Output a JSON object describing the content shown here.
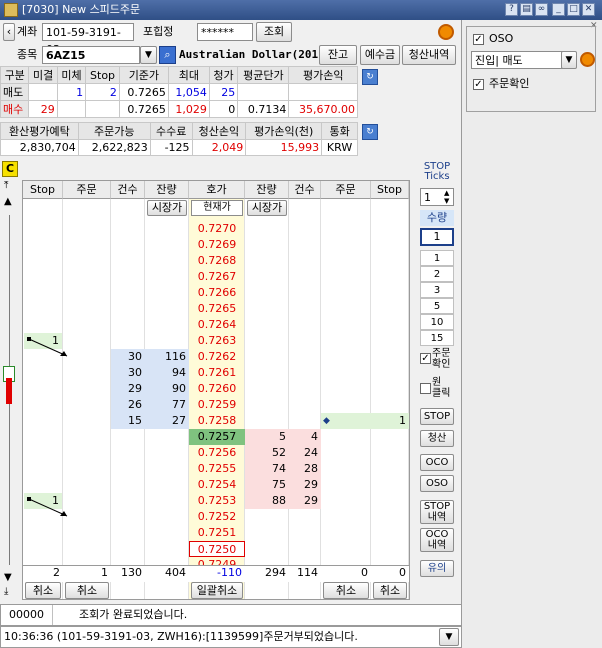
{
  "window": {
    "title": "[7030] New 스피드주문"
  },
  "account": {
    "label": "계좌",
    "number": "101-59-3191-03",
    "pw_label": "포힙정",
    "password": "******",
    "query_button": "조회"
  },
  "symbol": {
    "label": "종목",
    "code": "6AZ15",
    "name": "Australian Dollar(201",
    "balance_button": "잔고",
    "deposit_button": "예수금",
    "settlement_button": "청산내역"
  },
  "position_table": {
    "headers": [
      "구분",
      "미결",
      "미체",
      "Stop",
      "기준가",
      "최대",
      "청가",
      "평균단가",
      "평가손익"
    ],
    "rows": [
      [
        "매도",
        "",
        "1",
        "2",
        "0.7265",
        "1,054",
        "25",
        "",
        ""
      ],
      [
        "매수",
        "29",
        "",
        "",
        "0.7265",
        "1,029",
        "0",
        "0.7134",
        "35,670.00"
      ]
    ]
  },
  "balance_table": {
    "headers": [
      "환산평가예탁",
      "주문가능",
      "수수료",
      "청산손익",
      "평가손익(천)",
      "통화"
    ],
    "row": [
      "2,830,704",
      "2,622,823",
      "-125",
      "2,049",
      "15,993",
      "KRW"
    ]
  },
  "grid": {
    "headers": [
      "Stop",
      "주문",
      "건수",
      "잔량",
      "호가",
      "잔량",
      "건수",
      "주문",
      "Stop"
    ],
    "market_left": "시장가",
    "current_label": "현재가",
    "market_right": "시장가",
    "corner": "C",
    "prices": [
      "0.7270",
      "0.7269",
      "0.7268",
      "0.7267",
      "0.7266",
      "0.7265",
      "0.7264",
      "0.7263",
      "0.7262",
      "0.7261",
      "0.7260",
      "0.7259",
      "0.7258",
      "0.7257",
      "0.7256",
      "0.7255",
      "0.7254",
      "0.7253",
      "0.7252",
      "0.7251",
      "0.7250",
      "0.7249"
    ],
    "current_price": "0.7257",
    "selected_price": "0.7250",
    "ask_counts": [
      "30",
      "30",
      "29",
      "26",
      "15"
    ],
    "ask_qty": [
      "116",
      "94",
      "90",
      "77",
      "27"
    ],
    "bid_qty": [
      "5",
      "52",
      "74",
      "75",
      "88"
    ],
    "bid_counts": [
      "4",
      "24",
      "28",
      "29",
      "29"
    ],
    "stop_left_a": "1",
    "stop_left_b": "1",
    "stop_right": "1",
    "footer": [
      "2",
      "1",
      "130",
      "404",
      "-110",
      "294",
      "114",
      "0",
      "0"
    ],
    "cancel_left": "취소",
    "cancel_left2": "취소",
    "cancel_all": "일괄취소",
    "cancel_right": "취소",
    "cancel_right2": "취소"
  },
  "side": {
    "stop_ticks": "STOP\nTicks",
    "tick_value": "1",
    "qty_label": "수량",
    "qty_value": "1",
    "qty_options": [
      "1",
      "2",
      "3",
      "5",
      "10",
      "15"
    ],
    "confirm_label": "주문\n확인",
    "oneclick_label": "원\n클릭",
    "stop_btn": "STOP",
    "clear_btn": "청산",
    "oco_btn": "OCO",
    "oso_btn": "OSO",
    "stop_hist": "STOP\n내역",
    "oco_hist": "OCO\n내역",
    "info_btn": "유의"
  },
  "status": {
    "code": "00000",
    "message": "조회가 완료되었습니다.",
    "log": "10:36:36 (101-59-3191-03, ZWH16):[1139599]주문거부되었습니다."
  },
  "oso_panel": {
    "title": "OSO",
    "select_value": "진입| 매도",
    "confirm_label": "주문확인"
  },
  "colors": {
    "ask_bg": "#d8e4f6",
    "bid_bg": "#fbdede",
    "price_bg": "#fffbd8",
    "current_bg": "#7fc27f",
    "red": "#e00000",
    "blue": "#0000e0"
  }
}
